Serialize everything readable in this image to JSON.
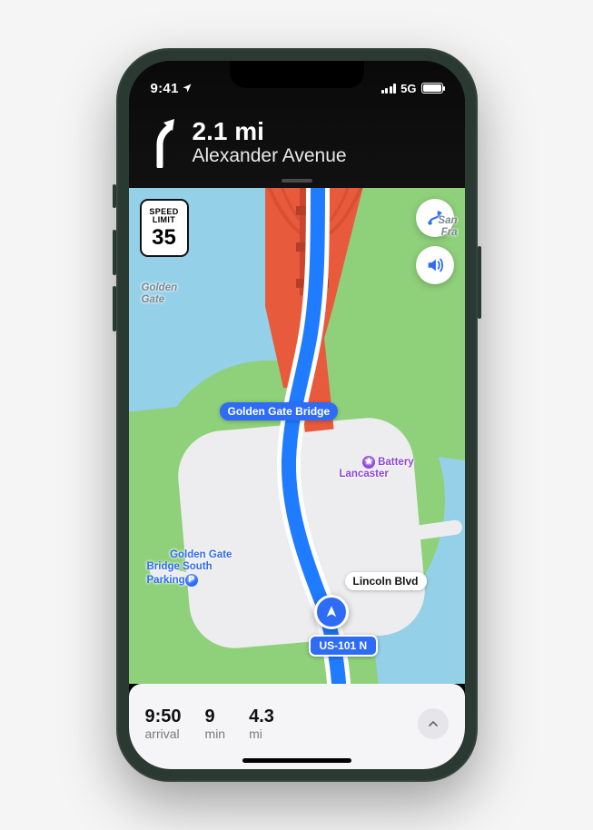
{
  "status_bar": {
    "time": "9:41",
    "network": "5G"
  },
  "navigation": {
    "distance": "2.1 mi",
    "road": "Alexander Avenue",
    "maneuver": "bear-right"
  },
  "speed_limit": {
    "line1": "SPEED",
    "line2": "LIMIT",
    "value": "35"
  },
  "map": {
    "chips": {
      "ggb": "Golden Gate Bridge",
      "lincoln": "Lincoln Blvd",
      "route_shield": "US-101 N"
    },
    "poi": {
      "battery": "Battery\nLancaster",
      "parking": "Golden Gate\nBridge South\nParking",
      "water_label_nw": "Golden\nGate",
      "water_label_ne": "San\nFra"
    },
    "controls": {
      "overview": "route-overview",
      "audio": "voice-guidance"
    }
  },
  "trip": {
    "arrival_value": "9:50",
    "arrival_label": "arrival",
    "duration_value": "9",
    "duration_label": "min",
    "distance_value": "4.3",
    "distance_label": "mi"
  }
}
